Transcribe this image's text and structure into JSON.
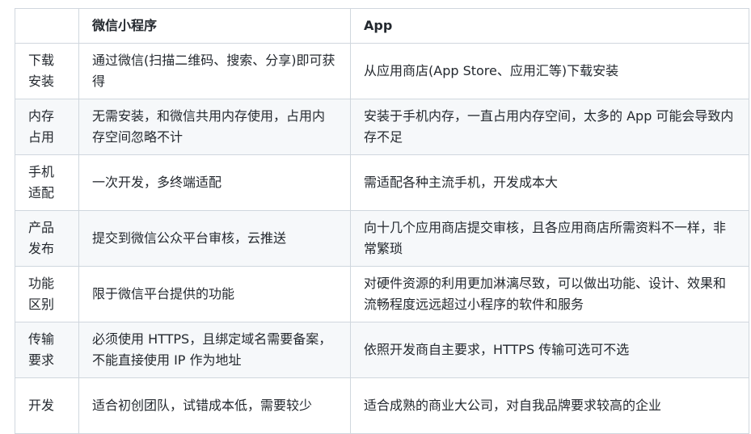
{
  "table": {
    "headers": [
      "",
      "微信小程序",
      "App"
    ],
    "rows": [
      {
        "label": "下载安装",
        "mini_program": "通过微信(扫描二维码、搜索、分享)即可获得",
        "app": "从应用商店(App Store、应用汇等)下载安装"
      },
      {
        "label": "内存占用",
        "mini_program": "无需安装，和微信共用内存使用，占用内存空间忽略不计",
        "app": "安装于手机内存，一直占用内存空间，太多的 App 可能会导致内存不足"
      },
      {
        "label": "手机适配",
        "mini_program": "一次开发，多终端适配",
        "app": "需适配各种主流手机，开发成本大"
      },
      {
        "label": "产品发布",
        "mini_program": "提交到微信公众平台审核，云推送",
        "app": "向十几个应用商店提交审核，且各应用商店所需资料不一样，非常繁琐"
      },
      {
        "label": "功能区别",
        "mini_program": "限于微信平台提供的功能",
        "app": "对硬件资源的利用更加淋漓尽致，可以做出功能、设计、效果和流畅程度远远超过小程序的软件和服务"
      },
      {
        "label": "传输要求",
        "mini_program": "必须使用 HTTPS，且绑定域名需要备案，不能直接使用 IP 作为地址",
        "app": "依照开发商自主要求，HTTPS 传输可选可不选"
      },
      {
        "label": "开发",
        "mini_program": "适合初创团队，试错成本低，需要较少",
        "app": "适合成熟的商业大公司，对自我品牌要求较高的企业"
      }
    ]
  }
}
